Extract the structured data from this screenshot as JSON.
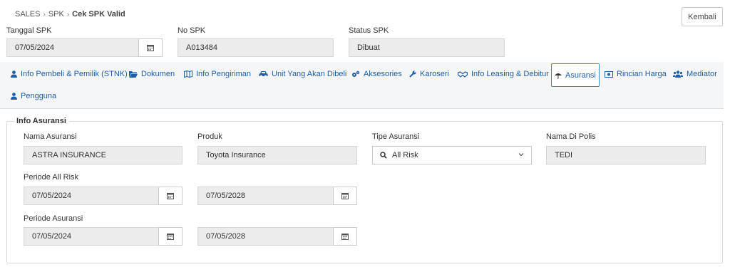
{
  "breadcrumb": {
    "items": [
      "SALES",
      "SPK"
    ],
    "current": "Cek SPK Valid"
  },
  "header": {
    "back_label": "Kembali"
  },
  "spk": {
    "tanggal_label": "Tanggal SPK",
    "tanggal_value": "07/05/2024",
    "no_label": "No SPK",
    "no_value": "A013484",
    "status_label": "Status SPK",
    "status_value": "Dibuat"
  },
  "tabs": [
    {
      "label": "Info Pembeli & Pemilik (STNK)",
      "icon": "user-icon"
    },
    {
      "label": "Dokumen",
      "icon": "folder-icon"
    },
    {
      "label": "Info Pengiriman",
      "icon": "map-icon"
    },
    {
      "label": "Unit Yang Akan Dibeli",
      "icon": "car-icon"
    },
    {
      "label": "Aksesories",
      "icon": "cogs-icon"
    },
    {
      "label": "Karoseri",
      "icon": "wrench-icon"
    },
    {
      "label": "Info Leasing & Debitur",
      "icon": "handshake-icon"
    },
    {
      "label": "Asuransi",
      "icon": "umbrella-icon",
      "active": true
    },
    {
      "label": "Rincian Harga",
      "icon": "money-icon"
    },
    {
      "label": "Mediator",
      "icon": "users-icon"
    },
    {
      "label": "Pengguna",
      "icon": "user-icon"
    }
  ],
  "asuransi": {
    "section_title": "Info Asuransi",
    "nama_label": "Nama Asuransi",
    "nama_value": "ASTRA INSURANCE",
    "produk_label": "Produk",
    "produk_value": "Toyota Insurance",
    "tipe_label": "Tipe Asuransi",
    "tipe_value": "All Risk",
    "polis_label": "Nama Di Polis",
    "polis_value": "TEDI",
    "periode_allrisk_label": "Periode All Risk",
    "periode_allrisk_start": "07/05/2024",
    "periode_allrisk_end": "07/05/2028",
    "periode_asuransi_label": "Periode Asuransi",
    "periode_asuransi_start": "07/05/2024",
    "periode_asuransi_end": "07/05/2028"
  },
  "colors": {
    "link": "#1f5fa8",
    "active_border": "#3c8dbc",
    "readonly_bg": "#ececec"
  }
}
